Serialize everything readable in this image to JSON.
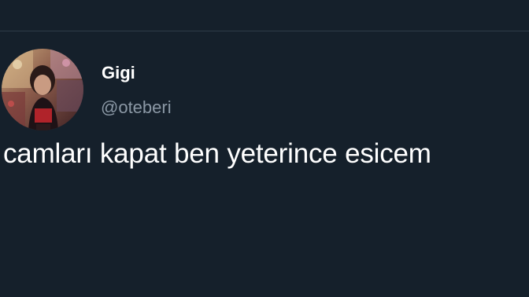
{
  "tweet": {
    "author": {
      "display_name": "Gigi",
      "handle": "@oteberi",
      "avatar_icon": "profile-photo-avatar"
    },
    "text": "camları kapat ben yeterince esicem"
  },
  "colors": {
    "background": "#15202b",
    "divider": "#2f3c49",
    "primary_text": "#ffffff",
    "secondary_text": "#8b98a5"
  }
}
